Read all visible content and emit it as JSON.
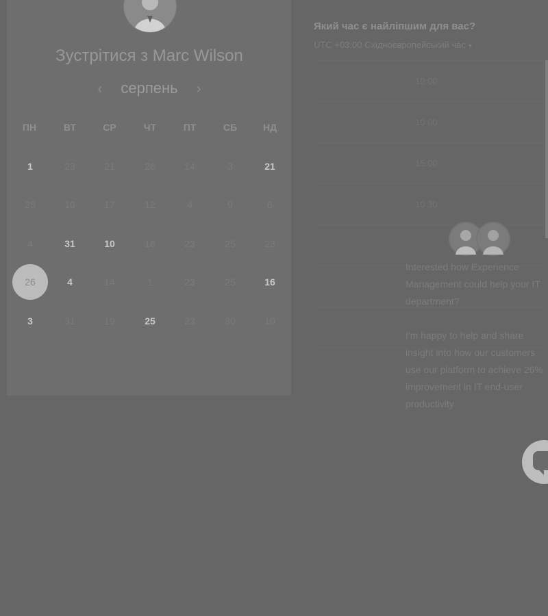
{
  "title": "Зустрітися з Marc Wilson",
  "month": {
    "label": "серпень",
    "prev_icon": "chevron-left-icon",
    "next_icon": "chevron-right-icon"
  },
  "weekdays": [
    "ПН",
    "ВТ",
    "СР",
    "ЧТ",
    "ПТ",
    "СБ",
    "НД"
  ],
  "calendar_rows": [
    [
      {
        "d": "1",
        "available": true
      },
      {
        "d": "23",
        "available": false
      },
      {
        "d": "21",
        "available": false
      },
      {
        "d": "26",
        "available": false
      },
      {
        "d": "14",
        "available": false
      },
      {
        "d": "3",
        "available": false
      },
      {
        "d": "21",
        "available": true
      }
    ],
    [
      {
        "d": "25",
        "available": false
      },
      {
        "d": "10",
        "available": false
      },
      {
        "d": "17",
        "available": false
      },
      {
        "d": "12",
        "available": false
      },
      {
        "d": "4",
        "available": false
      },
      {
        "d": "9",
        "available": false
      },
      {
        "d": "6",
        "available": false
      }
    ],
    [
      {
        "d": "4",
        "available": false
      },
      {
        "d": "31",
        "available": true
      },
      {
        "d": "10",
        "available": true
      },
      {
        "d": "16",
        "available": false
      },
      {
        "d": "23",
        "available": false
      },
      {
        "d": "25",
        "available": false
      },
      {
        "d": "23",
        "available": false
      }
    ],
    [
      {
        "d": "26",
        "available": false,
        "selected": true
      },
      {
        "d": "4",
        "available": true
      },
      {
        "d": "14",
        "available": false
      },
      {
        "d": "1",
        "available": false
      },
      {
        "d": "23",
        "available": false
      },
      {
        "d": "25",
        "available": false
      },
      {
        "d": "16",
        "available": true
      }
    ],
    [
      {
        "d": "3",
        "available": true
      },
      {
        "d": "31",
        "available": false
      },
      {
        "d": "19",
        "available": false
      },
      {
        "d": "25",
        "available": true
      },
      {
        "d": "23",
        "available": false
      },
      {
        "d": "30",
        "available": false
      },
      {
        "d": "10",
        "available": false
      }
    ]
  ],
  "time_question": "Який час є найліпшим для вас?",
  "timezone": "UTC +03:00 Східноєвропейський час",
  "time_slots": [
    "10:00",
    "10:00",
    "15:00",
    "10:30",
    "",
    "",
    "",
    ""
  ],
  "chat_popup": {
    "message_1": "Interested how Experience Management could help your IT department?",
    "message_2": "I'm happy to help and share insight into how our customers use our platform to achieve 26% improvement in IT end-user productivity"
  },
  "chat_launcher_icon": "chat-bubble-icon",
  "colors": {
    "background": "#666666",
    "panel": "#6e6e6e",
    "selected_day": "#bcbcbc",
    "available_day": "#c9c9c9"
  }
}
